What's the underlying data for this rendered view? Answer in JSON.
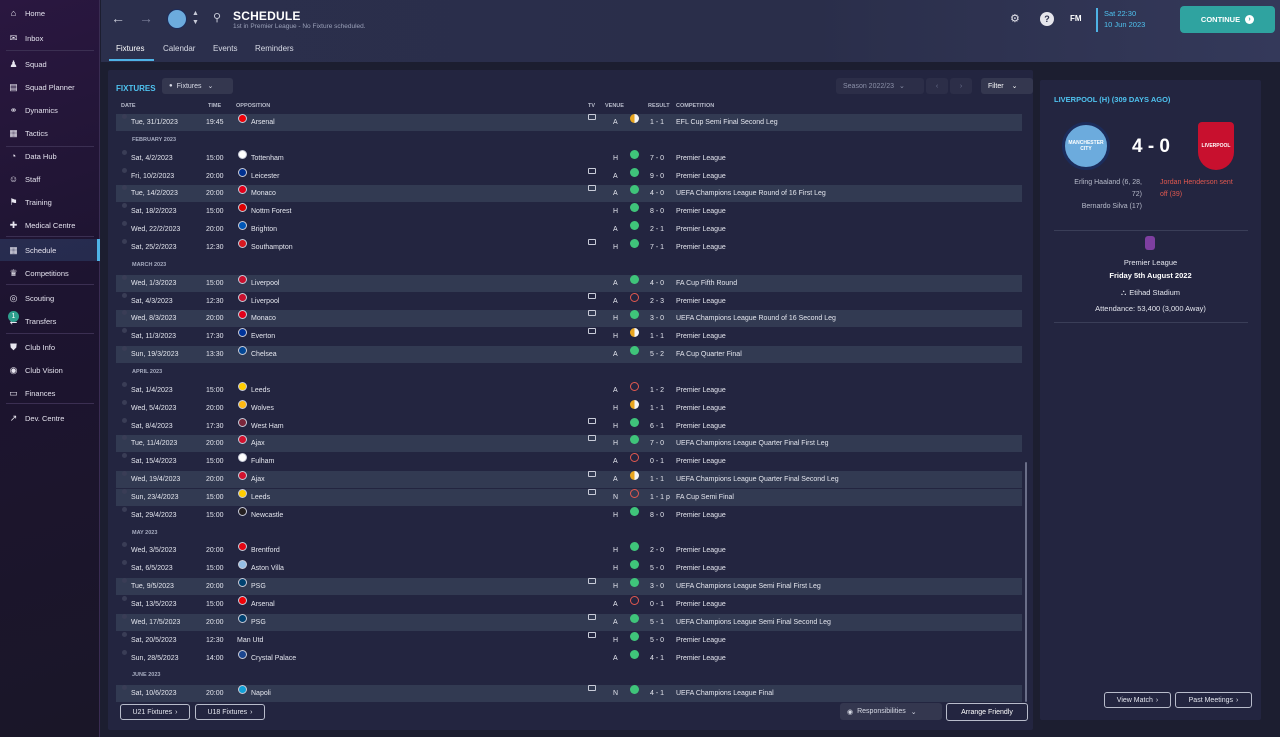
{
  "sidebar": {
    "items": [
      {
        "label": "Home",
        "icon": "home-icon"
      },
      {
        "label": "Inbox",
        "icon": "inbox-icon"
      },
      {
        "label": "Squad",
        "icon": "squad-icon"
      },
      {
        "label": "Squad Planner",
        "icon": "planner-icon"
      },
      {
        "label": "Dynamics",
        "icon": "dynamics-icon"
      },
      {
        "label": "Tactics",
        "icon": "tactics-icon"
      },
      {
        "label": "Data Hub",
        "icon": "data-hub-icon"
      },
      {
        "label": "Staff",
        "icon": "staff-icon"
      },
      {
        "label": "Training",
        "icon": "training-icon"
      },
      {
        "label": "Medical Centre",
        "icon": "medical-icon"
      },
      {
        "label": "Schedule",
        "icon": "calendar-icon"
      },
      {
        "label": "Competitions",
        "icon": "trophy-icon"
      },
      {
        "label": "Scouting",
        "icon": "scouting-icon"
      },
      {
        "label": "Transfers",
        "icon": "transfers-icon"
      },
      {
        "label": "Club Info",
        "icon": "shield-icon"
      },
      {
        "label": "Club Vision",
        "icon": "vision-icon"
      },
      {
        "label": "Finances",
        "icon": "finances-icon"
      },
      {
        "label": "Dev. Centre",
        "icon": "dev-centre-icon"
      }
    ],
    "transfers_badge": "1"
  },
  "header": {
    "title": "SCHEDULE",
    "subtitle": "1st in Premier League - No Fixture scheduled.",
    "tabs": [
      "Fixtures",
      "Calendar",
      "Events",
      "Reminders"
    ],
    "help": "?",
    "fm": "FM",
    "time": "Sat 22:30",
    "date": "10 Jun 2023",
    "continue": "CONTINUE"
  },
  "main": {
    "title": "FIXTURES",
    "view_dropdown": "Fixtures",
    "season": "Season 2022/23",
    "filter": "Filter",
    "columns": {
      "date": "DATE",
      "time": "TIME",
      "opposition": "OPPOSITION",
      "tv": "TV",
      "venue": "VENUE",
      "result": "RESULT",
      "competition": "COMPETITION"
    },
    "rows": [
      {
        "date": "Tue, 31/1/2023",
        "time": "19:45",
        "opp": "Arsenal",
        "crest": "#ef0107",
        "tv": true,
        "venue": "A",
        "res": "D",
        "score": "1 - 1",
        "comp": "EFL Cup Semi Final Second Leg",
        "hl": true
      },
      {
        "month": "FEBRUARY 2023"
      },
      {
        "date": "Sat, 4/2/2023",
        "time": "15:00",
        "opp": "Tottenham",
        "crest": "#ffffff",
        "tv": false,
        "venue": "H",
        "res": "W",
        "score": "7 - 0",
        "comp": "Premier League"
      },
      {
        "date": "Fri, 10/2/2023",
        "time": "20:00",
        "opp": "Leicester",
        "crest": "#003090",
        "tv": true,
        "venue": "A",
        "res": "W",
        "score": "9 - 0",
        "comp": "Premier League"
      },
      {
        "date": "Tue, 14/2/2023",
        "time": "20:00",
        "opp": "Monaco",
        "crest": "#e2001a",
        "tv": true,
        "venue": "A",
        "res": "W",
        "score": "4 - 0",
        "comp": "UEFA Champions League Round of 16 First Leg",
        "hl": true
      },
      {
        "date": "Sat, 18/2/2023",
        "time": "15:00",
        "opp": "Nottm Forest",
        "crest": "#dd0000",
        "tv": false,
        "venue": "H",
        "res": "W",
        "score": "8 - 0",
        "comp": "Premier League"
      },
      {
        "date": "Wed, 22/2/2023",
        "time": "20:00",
        "opp": "Brighton",
        "crest": "#0057b8",
        "tv": false,
        "venue": "A",
        "res": "W",
        "score": "2 - 1",
        "comp": "Premier League"
      },
      {
        "date": "Sat, 25/2/2023",
        "time": "12:30",
        "opp": "Southampton",
        "crest": "#d71920",
        "tv": true,
        "venue": "H",
        "res": "W",
        "score": "7 - 1",
        "comp": "Premier League"
      },
      {
        "month": "MARCH 2023"
      },
      {
        "date": "Wed, 1/3/2023",
        "time": "15:00",
        "opp": "Liverpool",
        "crest": "#c8102e",
        "tv": false,
        "venue": "A",
        "res": "W",
        "score": "4 - 0",
        "comp": "FA Cup Fifth Round",
        "hl": true
      },
      {
        "date": "Sat, 4/3/2023",
        "time": "12:30",
        "opp": "Liverpool",
        "crest": "#c8102e",
        "tv": true,
        "venue": "A",
        "res": "L",
        "score": "2 - 3",
        "comp": "Premier League"
      },
      {
        "date": "Wed, 8/3/2023",
        "time": "20:00",
        "opp": "Monaco",
        "crest": "#e2001a",
        "tv": true,
        "venue": "H",
        "res": "W",
        "score": "3 - 0",
        "comp": "UEFA Champions League Round of 16 Second Leg",
        "hl": true
      },
      {
        "date": "Sat, 11/3/2023",
        "time": "17:30",
        "opp": "Everton",
        "crest": "#003399",
        "tv": true,
        "venue": "H",
        "res": "D",
        "score": "1 - 1",
        "comp": "Premier League"
      },
      {
        "date": "Sun, 19/3/2023",
        "time": "13:30",
        "opp": "Chelsea",
        "crest": "#034694",
        "tv": false,
        "venue": "A",
        "res": "W",
        "score": "5 - 2",
        "comp": "FA Cup Quarter Final",
        "hl": true
      },
      {
        "month": "APRIL 2023"
      },
      {
        "date": "Sat, 1/4/2023",
        "time": "15:00",
        "opp": "Leeds",
        "crest": "#ffcd00",
        "tv": false,
        "venue": "A",
        "res": "L",
        "score": "1 - 2",
        "comp": "Premier League"
      },
      {
        "date": "Wed, 5/4/2023",
        "time": "20:00",
        "opp": "Wolves",
        "crest": "#fdb913",
        "tv": false,
        "venue": "H",
        "res": "D",
        "score": "1 - 1",
        "comp": "Premier League"
      },
      {
        "date": "Sat, 8/4/2023",
        "time": "17:30",
        "opp": "West Ham",
        "crest": "#7a263a",
        "tv": true,
        "venue": "H",
        "res": "W",
        "score": "6 - 1",
        "comp": "Premier League"
      },
      {
        "date": "Tue, 11/4/2023",
        "time": "20:00",
        "opp": "Ajax",
        "crest": "#d2122e",
        "tv": true,
        "venue": "H",
        "res": "W",
        "score": "7 - 0",
        "comp": "UEFA Champions League Quarter Final First Leg",
        "hl": true
      },
      {
        "date": "Sat, 15/4/2023",
        "time": "15:00",
        "opp": "Fulham",
        "crest": "#ffffff",
        "tv": false,
        "venue": "A",
        "res": "L",
        "score": "0 - 1",
        "comp": "Premier League"
      },
      {
        "date": "Wed, 19/4/2023",
        "time": "20:00",
        "opp": "Ajax",
        "crest": "#d2122e",
        "tv": true,
        "venue": "A",
        "res": "D",
        "score": "1 - 1",
        "comp": "UEFA Champions League Quarter Final Second Leg",
        "hl": true
      },
      {
        "date": "Sun, 23/4/2023",
        "time": "15:00",
        "opp": "Leeds",
        "crest": "#ffcd00",
        "tv": true,
        "venue": "N",
        "res": "L",
        "score": "1 - 1 p",
        "comp": "FA Cup Semi Final",
        "hl": true
      },
      {
        "date": "Sat, 29/4/2023",
        "time": "15:00",
        "opp": "Newcastle",
        "crest": "#241f20",
        "tv": false,
        "venue": "H",
        "res": "W",
        "score": "8 - 0",
        "comp": "Premier League"
      },
      {
        "month": "MAY 2023"
      },
      {
        "date": "Wed, 3/5/2023",
        "time": "20:00",
        "opp": "Brentford",
        "crest": "#e30613",
        "tv": false,
        "venue": "H",
        "res": "W",
        "score": "2 - 0",
        "comp": "Premier League"
      },
      {
        "date": "Sat, 6/5/2023",
        "time": "15:00",
        "opp": "Aston Villa",
        "crest": "#95bfe5",
        "tv": false,
        "venue": "H",
        "res": "W",
        "score": "5 - 0",
        "comp": "Premier League"
      },
      {
        "date": "Tue, 9/5/2023",
        "time": "20:00",
        "opp": "PSG",
        "crest": "#004170",
        "tv": true,
        "venue": "H",
        "res": "W",
        "score": "3 - 0",
        "comp": "UEFA Champions League Semi Final First Leg",
        "hl": true
      },
      {
        "date": "Sat, 13/5/2023",
        "time": "15:00",
        "opp": "Arsenal",
        "crest": "#ef0107",
        "tv": false,
        "venue": "A",
        "res": "L",
        "score": "0 - 1",
        "comp": "Premier League"
      },
      {
        "date": "Wed, 17/5/2023",
        "time": "20:00",
        "opp": "PSG",
        "crest": "#004170",
        "tv": true,
        "venue": "A",
        "res": "W",
        "score": "5 - 1",
        "comp": "UEFA Champions League Semi Final Second Leg",
        "hl": true
      },
      {
        "date": "Sat, 20/5/2023",
        "time": "12:30",
        "opp": "Man Utd",
        "crest": "",
        "tv": true,
        "venue": "H",
        "res": "W",
        "score": "5 - 0",
        "comp": "Premier League"
      },
      {
        "date": "Sun, 28/5/2023",
        "time": "14:00",
        "opp": "Crystal Palace",
        "crest": "#1b458f",
        "tv": false,
        "venue": "A",
        "res": "W",
        "score": "4 - 1",
        "comp": "Premier League"
      },
      {
        "month": "JUNE 2023"
      },
      {
        "date": "Sat, 10/6/2023",
        "time": "20:00",
        "opp": "Napoli",
        "crest": "#12a0d7",
        "tv": true,
        "venue": "N",
        "res": "W",
        "score": "4 - 1",
        "comp": "UEFA Champions League Final",
        "hl": true
      }
    ],
    "u21": "U21 Fixtures",
    "u18": "U18 Fixtures",
    "responsibilities": "Responsibilities",
    "arrange": "Arrange Friendly"
  },
  "side": {
    "title": "LIVERPOOL (H) (309 DAYS AGO)",
    "home_crest": "MANCHESTER CITY",
    "away_crest": "LIVERPOOL",
    "score": "4 - 0",
    "home_scorers": [
      "Erling Haaland (6, 28,",
      "72)",
      "Bernardo Silva (17)"
    ],
    "away_events": [
      "Jordan Henderson sent",
      "off (39)"
    ],
    "competition": "Premier League",
    "match_date": "Friday 5th August 2022",
    "stadium": "Etihad Stadium",
    "attendance": "Attendance: 53,400 (3,000 Away)",
    "view_match": "View Match",
    "past_meetings": "Past Meetings"
  }
}
